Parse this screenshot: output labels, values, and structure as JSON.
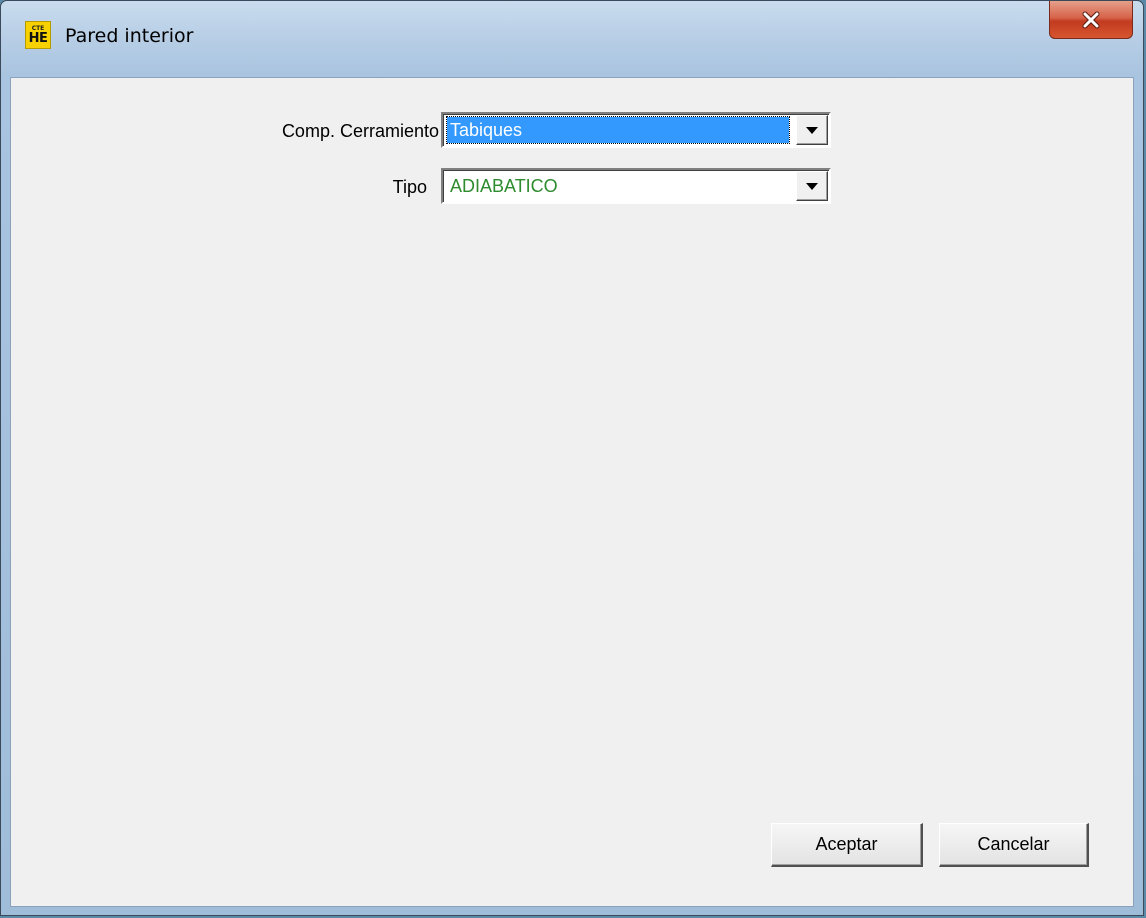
{
  "window": {
    "title": "Pared interior",
    "icon": {
      "name": "cte-he-app-icon",
      "line1": "CTE",
      "line2": "HE"
    },
    "close_icon": "close-icon"
  },
  "form": {
    "cerramiento": {
      "label": "Comp. Cerramiento",
      "value": "Tabiques"
    },
    "tipo": {
      "label": "Tipo",
      "value": "ADIABATICO",
      "value_color": "#2e8b2e"
    }
  },
  "buttons": {
    "accept": "Aceptar",
    "cancel": "Cancelar"
  },
  "colors": {
    "selection": "#3399ff",
    "close_button": "#c23b20",
    "app_icon": "#f7d200"
  }
}
